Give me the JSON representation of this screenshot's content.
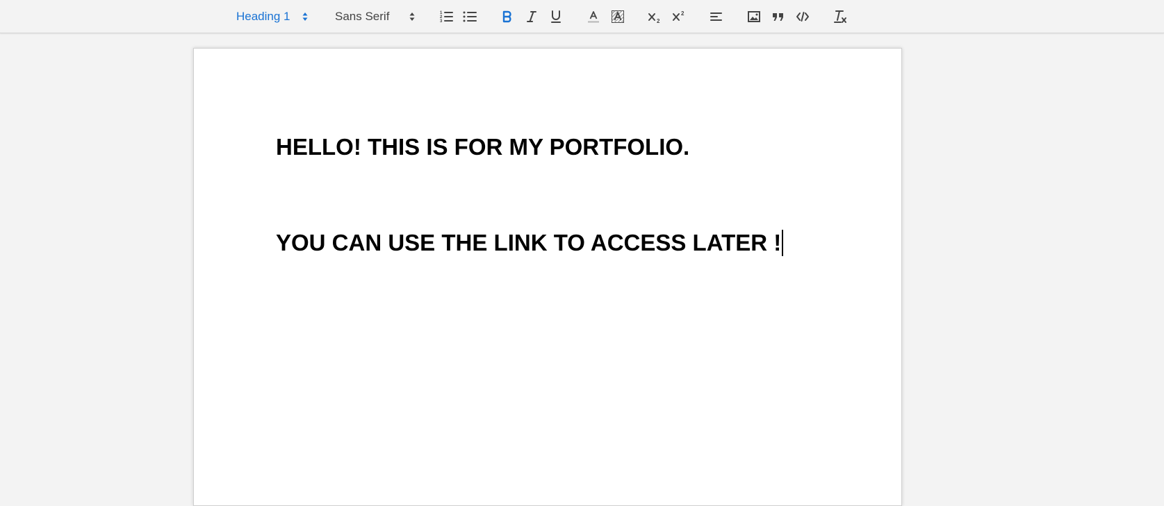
{
  "toolbar": {
    "header_picker": {
      "label": "Heading 1",
      "color": "#1a73d4"
    },
    "font_picker": {
      "label": "Sans Serif"
    },
    "buttons": [
      {
        "name": "ordered-list-icon"
      },
      {
        "name": "bullet-list-icon"
      },
      {
        "name": "bold-icon",
        "active": true,
        "active_color": "#1a73d4"
      },
      {
        "name": "italic-icon"
      },
      {
        "name": "underline-icon"
      },
      {
        "name": "text-color-icon"
      },
      {
        "name": "background-color-icon"
      },
      {
        "name": "subscript-icon"
      },
      {
        "name": "superscript-icon"
      },
      {
        "name": "align-left-icon"
      },
      {
        "name": "image-icon"
      },
      {
        "name": "blockquote-icon"
      },
      {
        "name": "code-block-icon"
      },
      {
        "name": "clear-formatting-icon"
      }
    ]
  },
  "document": {
    "lines": [
      "HELLO! THIS IS FOR MY PORTFOLIO.",
      "YOU CAN USE THE LINK TO ACCESS LATER !"
    ]
  }
}
